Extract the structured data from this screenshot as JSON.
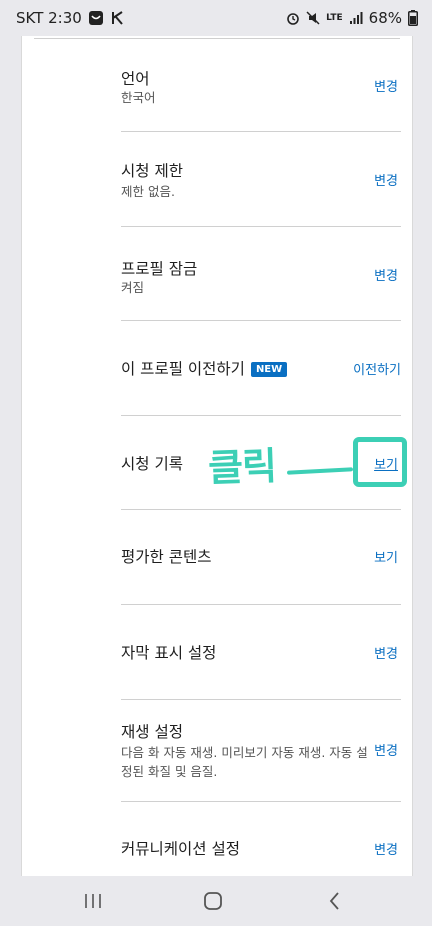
{
  "status_bar": {
    "carrier_time": "SKT 2:30",
    "battery": "68%",
    "network": "LTE"
  },
  "settings": {
    "rows": [
      {
        "title": "언어",
        "subtitle": "한국어",
        "action": "변경"
      },
      {
        "title": "시청 제한",
        "subtitle": "제한 없음.",
        "action": "변경"
      },
      {
        "title": "프로필 잠금",
        "subtitle": "켜짐",
        "action": "변경"
      },
      {
        "title": "이 프로필 이전하기",
        "badge": "NEW",
        "action": "이전하기"
      },
      {
        "title": "시청 기록",
        "action": "보기"
      },
      {
        "title": "평가한 콘텐츠",
        "action": "보기"
      },
      {
        "title": "자막 표시 설정",
        "action": "변경"
      },
      {
        "title": "재생 설정",
        "subtitle": "다음 화 자동 재생. 미리보기 자동 재생. 자동 설정된 화질 및 음질.",
        "action": "변경"
      },
      {
        "title": "커뮤니케이션 설정",
        "action": "변경"
      }
    ]
  },
  "annotation": {
    "text": "클릭"
  },
  "colors": {
    "accent": "#0a6fc2",
    "annotation": "#3ccfb5",
    "background": "#e9e9ed"
  }
}
